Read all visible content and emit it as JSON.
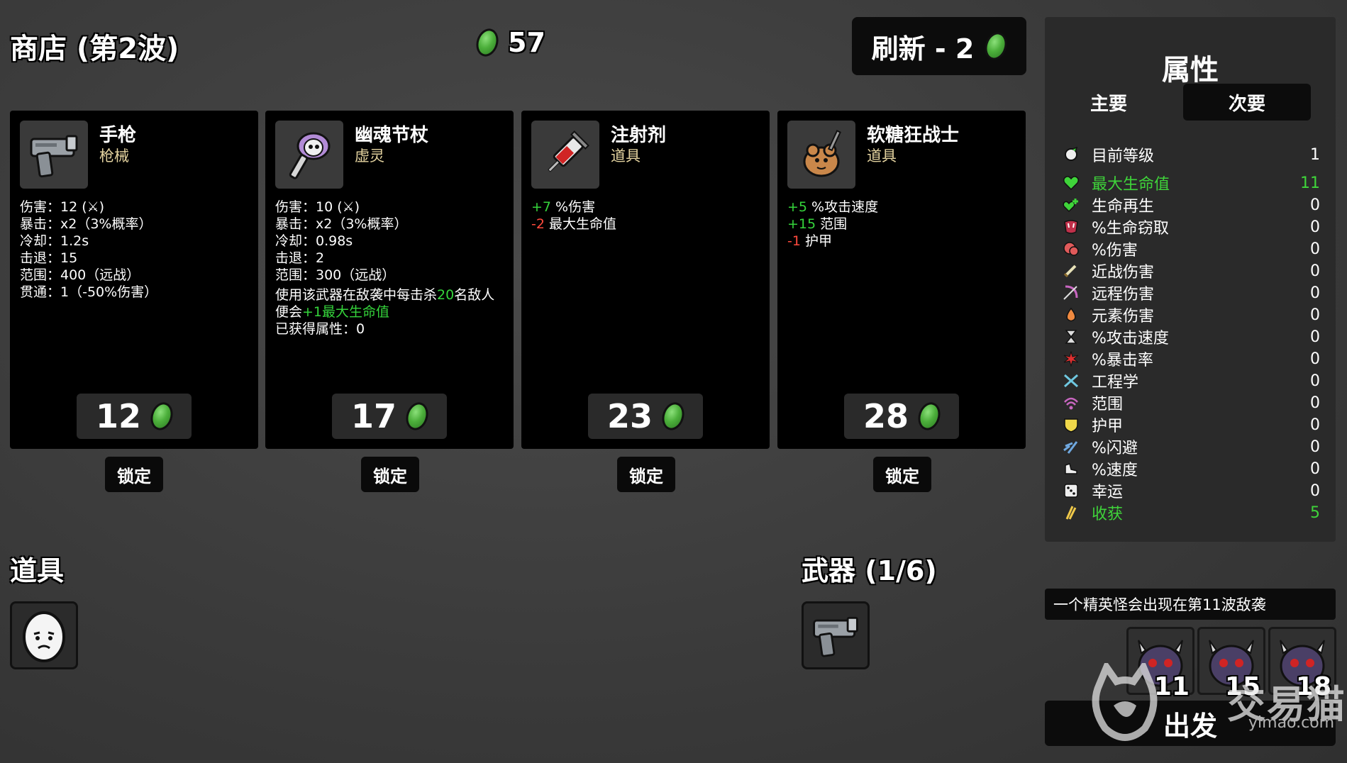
{
  "header": {
    "shop_title": "商店 (第2波)",
    "materials": "57",
    "reroll_label": "刷新 - 2"
  },
  "shop": [
    {
      "name": "手枪",
      "type": "枪械",
      "icon": "pistol-icon",
      "stats": [
        "伤害：12 (⚔)",
        "暴击：x2（3%概率）",
        "冷却：1.2s",
        "击退：15",
        "范围：400（远战）",
        "贯通：1（-50%伤害）"
      ],
      "price": "12",
      "lock_label": "锁定"
    },
    {
      "name": "幽魂节杖",
      "type": "虚灵",
      "icon": "ghost-scepter-icon",
      "stats": [
        "伤害：10 (⚔)",
        "暴击：x2（3%概率）",
        "冷却：0.98s",
        "击退：2",
        "范围：300（远战）"
      ],
      "effect_pre": "使用该武器在敌袭中每击杀",
      "effect_num": "20",
      "effect_mid": "名敌人便会",
      "effect_bonus": "+1最大生命值",
      "gained": "已获得属性：0",
      "price": "17",
      "lock_label": "锁定"
    },
    {
      "name": "注射剂",
      "type": "道具",
      "icon": "syringe-icon",
      "mods": [
        {
          "val": "+7",
          "text": " %伤害",
          "color": "green"
        },
        {
          "val": "-2",
          "text": " 最大生命值",
          "color": "red"
        }
      ],
      "price": "23",
      "lock_label": "锁定"
    },
    {
      "name": "软糖狂战士",
      "type": "道具",
      "icon": "gummy-berserker-icon",
      "mods": [
        {
          "val": "+5",
          "text": " %攻击速度",
          "color": "green"
        },
        {
          "val": "+15",
          "text": " 范围",
          "color": "green"
        },
        {
          "val": "-1",
          "text": " 护甲",
          "color": "red"
        }
      ],
      "price": "28",
      "lock_label": "锁定"
    }
  ],
  "inventory": {
    "items_title": "道具",
    "weapons_title": "武器 (1/6)"
  },
  "stats_panel": {
    "title": "属性",
    "tab_primary": "主要",
    "tab_secondary": "次要",
    "level_label": "目前等级",
    "level_value": "1",
    "rows": [
      {
        "label": "最大生命值",
        "value": "11",
        "highlight": true,
        "icon": "heart-icon"
      },
      {
        "label": "生命再生",
        "value": "0",
        "highlight": false,
        "icon": "regen-icon"
      },
      {
        "label": "%生命窃取",
        "value": "0",
        "highlight": false,
        "icon": "lifesteal-icon"
      },
      {
        "label": "%伤害",
        "value": "0",
        "highlight": false,
        "icon": "damage-icon"
      },
      {
        "label": "近战伤害",
        "value": "0",
        "highlight": false,
        "icon": "melee-icon"
      },
      {
        "label": "远程伤害",
        "value": "0",
        "highlight": false,
        "icon": "ranged-icon"
      },
      {
        "label": "元素伤害",
        "value": "0",
        "highlight": false,
        "icon": "elemental-icon"
      },
      {
        "label": "%攻击速度",
        "value": "0",
        "highlight": false,
        "icon": "hourglass-icon"
      },
      {
        "label": "%暴击率",
        "value": "0",
        "highlight": false,
        "icon": "crit-icon"
      },
      {
        "label": "工程学",
        "value": "0",
        "highlight": false,
        "icon": "engineering-icon"
      },
      {
        "label": "范围",
        "value": "0",
        "highlight": false,
        "icon": "range-icon"
      },
      {
        "label": "护甲",
        "value": "0",
        "highlight": false,
        "icon": "armor-icon"
      },
      {
        "label": "%闪避",
        "value": "0",
        "highlight": false,
        "icon": "dodge-icon"
      },
      {
        "label": "%速度",
        "value": "0",
        "highlight": false,
        "icon": "speed-icon"
      },
      {
        "label": "幸运",
        "value": "0",
        "highlight": false,
        "icon": "dice-icon"
      },
      {
        "label": "收获",
        "value": "5",
        "highlight": true,
        "icon": "harvest-icon"
      }
    ]
  },
  "elite": {
    "notice": "一个精英怪会出现在第11波敌袭",
    "waves": [
      "11",
      "15",
      "18"
    ]
  },
  "go_label": "出发",
  "watermark": {
    "text": "交易猫",
    "url": "yimao.com"
  },
  "colors": {
    "green": "#35d43b",
    "red": "#ff4a3d",
    "type_text": "#e5d4a0"
  }
}
